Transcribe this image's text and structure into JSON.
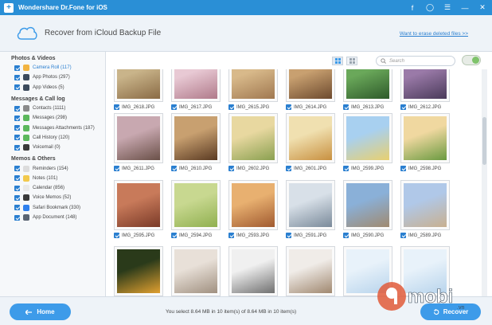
{
  "app": {
    "title": "Wondershare Dr.Fone for iOS"
  },
  "header": {
    "title": "Recover from iCloud Backup File",
    "link": "Want to erase deleted files >>"
  },
  "sidebar": {
    "sections": [
      {
        "title": "Photos & Videos",
        "items": [
          {
            "label": "Camera Roll (117)",
            "color": "#f2b441",
            "selected": true
          },
          {
            "label": "App Photos (297)",
            "color": "#3c4a5c",
            "selected": false
          },
          {
            "label": "App Videos (5)",
            "color": "#3c4a5c",
            "selected": false
          }
        ]
      },
      {
        "title": "Messages & Call log",
        "items": [
          {
            "label": "Contacts (1111)",
            "color": "#8a8a8a",
            "selected": false
          },
          {
            "label": "Messages (298)",
            "color": "#5cb85c",
            "selected": false
          },
          {
            "label": "Messages Attachments (187)",
            "color": "#5cb85c",
            "selected": false
          },
          {
            "label": "Call History (120)",
            "color": "#5cb85c",
            "selected": false
          },
          {
            "label": "Voicemail (0)",
            "color": "#3a3a3a",
            "selected": false
          }
        ]
      },
      {
        "title": "Memos & Others",
        "items": [
          {
            "label": "Reminders (154)",
            "color": "#dcdcdc",
            "selected": false
          },
          {
            "label": "Notes (101)",
            "color": "#f2c94c",
            "selected": false
          },
          {
            "label": "Calendar (856)",
            "color": "#e9e9e9",
            "selected": false
          },
          {
            "label": "Voice Memos (52)",
            "color": "#3a3a3a",
            "selected": false
          },
          {
            "label": "Safari Bookmark (330)",
            "color": "#2f80ed",
            "selected": false
          },
          {
            "label": "App Document (148)",
            "color": "#5a6472",
            "selected": false
          }
        ]
      }
    ]
  },
  "toolbar": {
    "search_placeholder": "Search"
  },
  "photos": [
    {
      "name": "IMG_2618.JPG",
      "c1": "#c9b48a",
      "c2": "#8a6b45"
    },
    {
      "name": "IMG_2617.JPG",
      "c1": "#e8c9d4",
      "c2": "#b07a8a"
    },
    {
      "name": "IMG_2615.JPG",
      "c1": "#d8b98a",
      "c2": "#a07850"
    },
    {
      "name": "IMG_2614.JPG",
      "c1": "#c8a070",
      "c2": "#6d4a2e"
    },
    {
      "name": "IMG_2613.JPG",
      "c1": "#6aa85a",
      "c2": "#2e5a2a"
    },
    {
      "name": "IMG_2612.JPG",
      "c1": "#9a7aa8",
      "c2": "#4a3a5a"
    },
    {
      "name": "IMG_2611.JPG",
      "c1": "#c8a8b0",
      "c2": "#6a5048"
    },
    {
      "name": "IMG_2610.JPG",
      "c1": "#c8a070",
      "c2": "#5a3a22"
    },
    {
      "name": "IMG_2602.JPG",
      "c1": "#e8d8a0",
      "c2": "#8aa050"
    },
    {
      "name": "IMG_2601.JPG",
      "c1": "#f0e0b0",
      "c2": "#c89040"
    },
    {
      "name": "IMG_2599.JPG",
      "c1": "#a8d0f0",
      "c2": "#e8d070"
    },
    {
      "name": "IMG_2598.JPG",
      "c1": "#f0d8a0",
      "c2": "#6a9a40"
    },
    {
      "name": "IMG_2595.JPG",
      "c1": "#c87a5a",
      "c2": "#7a3a28"
    },
    {
      "name": "IMG_2594.JPG",
      "c1": "#c8d890",
      "c2": "#90b050"
    },
    {
      "name": "IMG_2593.JPG",
      "c1": "#e8b070",
      "c2": "#a05a30"
    },
    {
      "name": "IMG_2591.JPG",
      "c1": "#d8e0e8",
      "c2": "#7a8a9a"
    },
    {
      "name": "IMG_2590.JPG",
      "c1": "#8ab0d8",
      "c2": "#a08a70"
    },
    {
      "name": "IMG_2589.JPG",
      "c1": "#b0c8e8",
      "c2": "#c8b090"
    },
    {
      "name": "",
      "c1": "#2a3a1a",
      "c2": "#e0a030"
    },
    {
      "name": "",
      "c1": "#e8e0d8",
      "c2": "#a09080"
    },
    {
      "name": "",
      "c1": "#f0f0f0",
      "c2": "#707070"
    },
    {
      "name": "",
      "c1": "#f0ece8",
      "c2": "#a08870"
    },
    {
      "name": "",
      "c1": "#e8f2fa",
      "c2": "#b8d4ec"
    },
    {
      "name": "",
      "c1": "#e8f2fa",
      "c2": "#b8d4ec"
    }
  ],
  "footer": {
    "home_label": "Home",
    "status": "You select 8.64 MB in 10 item(s) of 8.64 MB in 10 item(s)",
    "recover_label": "Recover"
  },
  "watermark": {
    "text": "9mobi",
    "sub": ".vn"
  }
}
